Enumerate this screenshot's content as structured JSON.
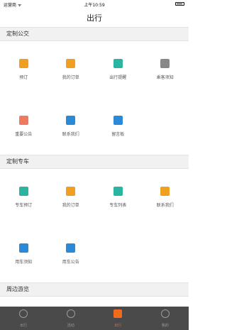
{
  "status_bar": {
    "carrier": "运营商 ᯤ",
    "time": "上午10:59"
  },
  "nav": {
    "title": "出行"
  },
  "sections": [
    {
      "title": "定制公交",
      "items": [
        {
          "label": "预订",
          "icon": "bus-icon",
          "color": "#f0a020"
        },
        {
          "label": "我的订单",
          "icon": "order-icon",
          "color": "#f0a020"
        },
        {
          "label": "出行提醒",
          "icon": "reminder-icon",
          "color": "#2bb5a0"
        },
        {
          "label": "乘客须知",
          "icon": "info-icon",
          "color": "#888888"
        },
        {
          "label": "重要公告",
          "icon": "announcement-icon",
          "color": "#f07a60"
        },
        {
          "label": "联系我们",
          "icon": "contact-icon",
          "color": "#2a8ad8"
        },
        {
          "label": "留言板",
          "icon": "message-icon",
          "color": "#2a8ad8"
        }
      ]
    },
    {
      "title": "定制专车",
      "items": [
        {
          "label": "专车预订",
          "icon": "car-booking-icon",
          "color": "#2bb5a0"
        },
        {
          "label": "我的订单",
          "icon": "order-icon",
          "color": "#f0a020"
        },
        {
          "label": "专车列表",
          "icon": "list-icon",
          "color": "#2bb5a0"
        },
        {
          "label": "联系我们",
          "icon": "person-icon",
          "color": "#f0a020"
        },
        {
          "label": "用车须知",
          "icon": "bell-icon",
          "color": "#2a8ad8"
        },
        {
          "label": "用车公告",
          "icon": "chat-icon",
          "color": "#2a8ad8"
        }
      ]
    },
    {
      "title": "周边游览",
      "items": []
    }
  ],
  "tabs": [
    {
      "label": "出行",
      "icon": "location-icon",
      "active": false
    },
    {
      "label": "活动",
      "icon": "star-icon",
      "active": false
    },
    {
      "label": "出行",
      "icon": "travel-icon",
      "active": true
    },
    {
      "label": "我的",
      "icon": "profile-icon",
      "active": false
    }
  ]
}
